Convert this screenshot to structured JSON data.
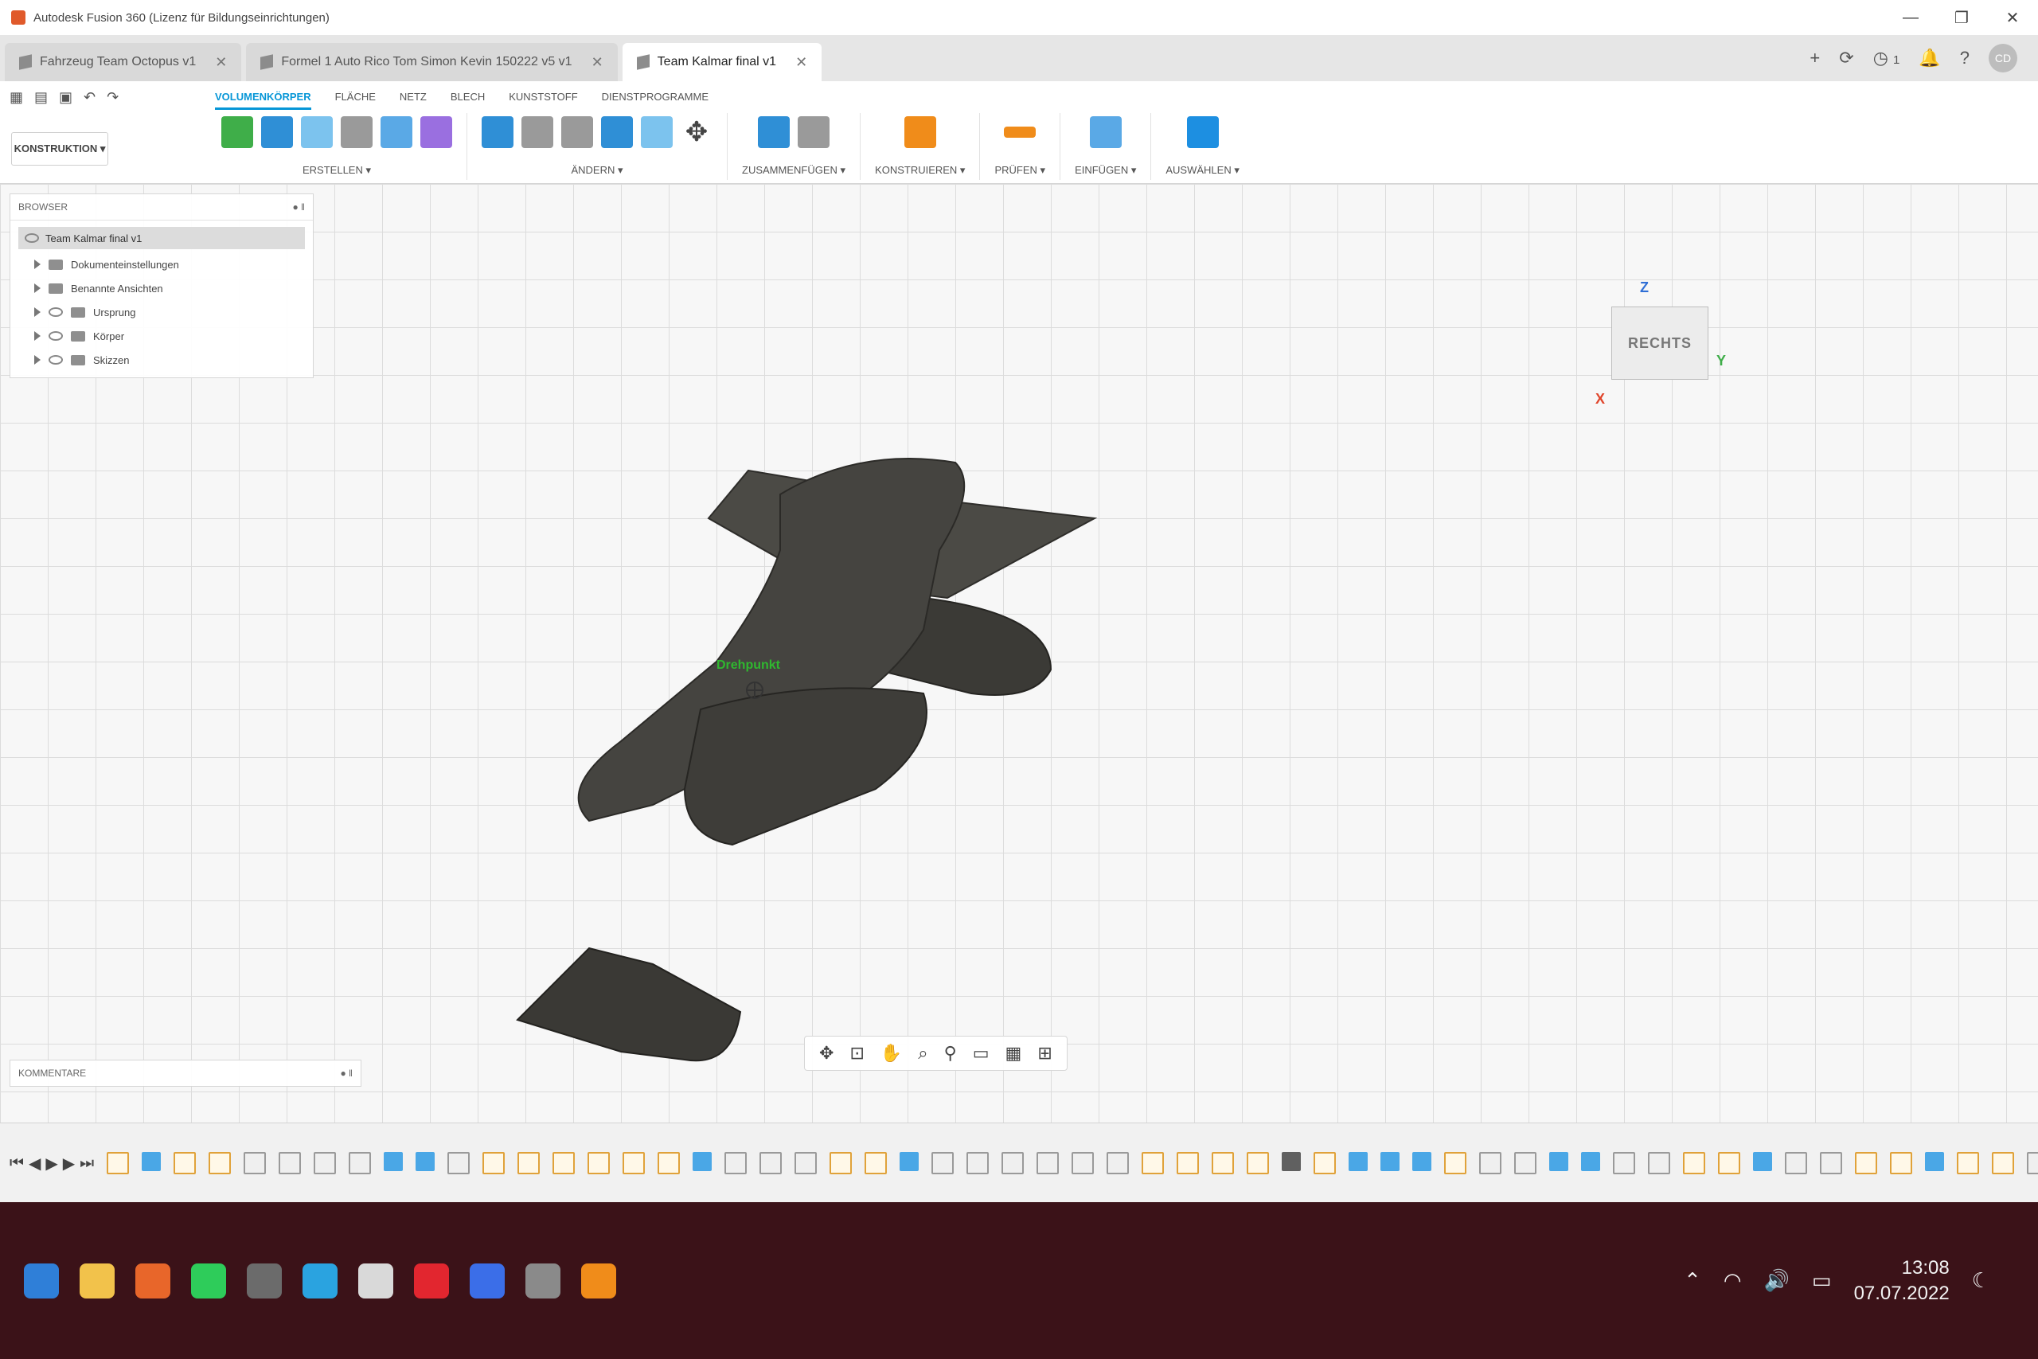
{
  "window": {
    "title": "Autodesk Fusion 360 (Lizenz für Bildungseinrichtungen)",
    "controls": [
      "—",
      "❐",
      "✕"
    ]
  },
  "tabs": [
    {
      "label": "Fahrzeug Team Octopus v1",
      "active": false
    },
    {
      "label": "Formel 1 Auto Rico Tom Simon Kevin 150222 v5 v1",
      "active": false
    },
    {
      "label": "Team Kalmar final v1",
      "active": true
    }
  ],
  "header_right": {
    "new_tab": "+",
    "job_status_count": "1",
    "avatar_initials": "CD"
  },
  "toolbar": {
    "workspace": "KONSTRUKTION ▾",
    "tabs": [
      {
        "label": "VOLUMENKÖRPER",
        "active": true
      },
      {
        "label": "FLÄCHE",
        "active": false
      },
      {
        "label": "NETZ",
        "active": false
      },
      {
        "label": "BLECH",
        "active": false
      },
      {
        "label": "KUNSTSTOFF",
        "active": false
      },
      {
        "label": "DIENSTPROGRAMME",
        "active": false
      }
    ],
    "groups": [
      {
        "label": "ERSTELLEN ▾",
        "icons": [
          "create-sketch-icon",
          "extrude-icon",
          "revolve-icon",
          "hole-icon",
          "pattern-icon",
          "form-icon"
        ]
      },
      {
        "label": "ÄNDERN ▾",
        "icons": [
          "press-pull-icon",
          "fillet-icon",
          "shell-icon",
          "combine-icon",
          "offset-face-icon",
          "move-icon"
        ]
      },
      {
        "label": "ZUSAMMENFÜGEN ▾",
        "icons": [
          "new-component-icon",
          "joint-icon"
        ]
      },
      {
        "label": "KONSTRUIEREN ▾",
        "icons": [
          "construct-plane-icon"
        ]
      },
      {
        "label": "PRÜFEN ▾",
        "icons": [
          "measure-icon"
        ]
      },
      {
        "label": "EINFÜGEN ▾",
        "icons": [
          "insert-image-icon"
        ]
      },
      {
        "label": "AUSWÄHLEN ▾",
        "icons": [
          "select-icon"
        ]
      }
    ]
  },
  "browser": {
    "title": "BROWSER",
    "root": "Team Kalmar final v1",
    "items": [
      "Dokumenteinstellungen",
      "Benannte Ansichten",
      "Ursprung",
      "Körper",
      "Skizzen"
    ]
  },
  "viewcube": {
    "face": "RECHTS",
    "axes": {
      "x": "X",
      "y": "Y",
      "z": "Z"
    }
  },
  "viewport": {
    "pivot_label": "Drehpunkt"
  },
  "comments": {
    "title": "KOMMENTARE"
  },
  "navbar": {
    "icons": [
      "orbit-icon",
      "look-at-icon",
      "pan-icon",
      "zoom-window-icon",
      "zoom-icon",
      "display-settings-icon",
      "grid-settings-icon",
      "viewports-icon"
    ]
  },
  "timeline": {
    "features": [
      "sketch",
      "extrude",
      "sketch",
      "sketch",
      "fillet",
      "fillet",
      "fillet",
      "fillet",
      "extrude",
      "extrude",
      "fillet",
      "sketch",
      "sketch",
      "sketch",
      "sketch",
      "sketch",
      "sketch",
      "extrude",
      "fillet",
      "fillet",
      "fillet",
      "sketch",
      "sketch",
      "extrude",
      "fillet",
      "fillet",
      "fillet",
      "fillet",
      "fillet",
      "fillet",
      "sketch",
      "sketch",
      "sketch",
      "sketch",
      "move",
      "sketch",
      "extrude",
      "extrude",
      "extrude",
      "sketch",
      "fillet",
      "fillet",
      "extrude",
      "extrude",
      "fillet",
      "fillet",
      "sketch",
      "sketch",
      "extrude",
      "fillet",
      "fillet",
      "sketch",
      "sketch",
      "extrude",
      "sketch",
      "sketch",
      "fillet"
    ]
  },
  "taskbar": {
    "apps": [
      {
        "name": "start",
        "color": "#2f7fd8"
      },
      {
        "name": "explorer",
        "color": "#f2c24b"
      },
      {
        "name": "firefox",
        "color": "#e8662a"
      },
      {
        "name": "whatsapp",
        "color": "#2ecc5a"
      },
      {
        "name": "calculator",
        "color": "#6b6b6b"
      },
      {
        "name": "telegram",
        "color": "#2aa3e0"
      },
      {
        "name": "chrome",
        "color": "#d9d9d9"
      },
      {
        "name": "opera",
        "color": "#e2262f"
      },
      {
        "name": "signal",
        "color": "#3b6ee8"
      },
      {
        "name": "inkscape",
        "color": "#8a8a8a"
      },
      {
        "name": "fusion",
        "color": "#f08c1a"
      }
    ],
    "time": "13:08",
    "date": "07.07.2022"
  }
}
